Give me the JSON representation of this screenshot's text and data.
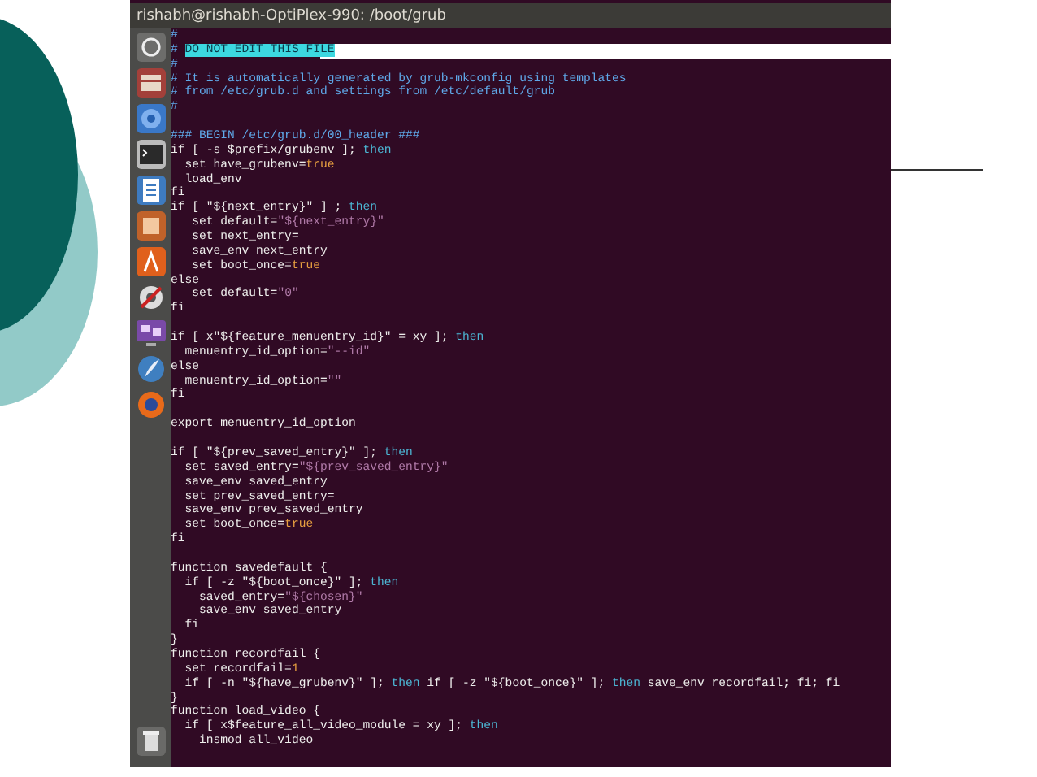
{
  "window": {
    "title": "rishabh@rishabh-OptiPlex-990: /boot/grub"
  },
  "terminal": {
    "lines": [
      {
        "kind": "code",
        "segments": [
          {
            "text": "#",
            "kind": "comment"
          }
        ]
      },
      {
        "kind": "code",
        "highlighted": true,
        "segments": [
          {
            "text": "# ",
            "kind": "comment"
          },
          {
            "text": "DO NOT EDIT THIS FILE",
            "kind": "selection"
          }
        ]
      },
      {
        "kind": "code",
        "segments": [
          {
            "text": "#",
            "kind": "comment"
          }
        ]
      },
      {
        "kind": "code",
        "segments": [
          {
            "text": "# It is automatically generated by grub-mkconfig using templates",
            "kind": "comment"
          }
        ]
      },
      {
        "kind": "code",
        "segments": [
          {
            "text": "# from /etc/grub.d and settings from /etc/default/grub",
            "kind": "comment"
          }
        ]
      },
      {
        "kind": "code",
        "segments": [
          {
            "text": "#",
            "kind": "comment"
          }
        ]
      },
      {
        "kind": "blank"
      },
      {
        "kind": "code",
        "segments": [
          {
            "text": "### BEGIN /etc/grub.d/00_header ###",
            "kind": "comment"
          }
        ]
      },
      {
        "kind": "code",
        "segments": [
          {
            "text": "if [ -s $prefix/grubenv ]; ",
            "kind": "text"
          },
          {
            "text": "then",
            "kind": "keyword"
          }
        ]
      },
      {
        "kind": "code",
        "segments": [
          {
            "text": "  set have_grubenv=",
            "kind": "text"
          },
          {
            "text": "true",
            "kind": "literal"
          }
        ]
      },
      {
        "kind": "code",
        "segments": [
          {
            "text": "  load_env",
            "kind": "text"
          }
        ]
      },
      {
        "kind": "code",
        "segments": [
          {
            "text": "fi",
            "kind": "text"
          }
        ]
      },
      {
        "kind": "code",
        "segments": [
          {
            "text": "if [ \"${next_entry}\" ] ; ",
            "kind": "text"
          },
          {
            "text": "then",
            "kind": "keyword"
          }
        ]
      },
      {
        "kind": "code",
        "segments": [
          {
            "text": "   set default=",
            "kind": "text"
          },
          {
            "text": "\"${next_entry}\"",
            "kind": "string"
          }
        ]
      },
      {
        "kind": "code",
        "segments": [
          {
            "text": "   set next_entry=",
            "kind": "text"
          }
        ]
      },
      {
        "kind": "code",
        "segments": [
          {
            "text": "   save_env next_entry",
            "kind": "text"
          }
        ]
      },
      {
        "kind": "code",
        "segments": [
          {
            "text": "   set boot_once=",
            "kind": "text"
          },
          {
            "text": "true",
            "kind": "literal"
          }
        ]
      },
      {
        "kind": "code",
        "segments": [
          {
            "text": "else",
            "kind": "text"
          }
        ]
      },
      {
        "kind": "code",
        "segments": [
          {
            "text": "   set default=",
            "kind": "text"
          },
          {
            "text": "\"0\"",
            "kind": "string"
          }
        ]
      },
      {
        "kind": "code",
        "segments": [
          {
            "text": "fi",
            "kind": "text"
          }
        ]
      },
      {
        "kind": "blank"
      },
      {
        "kind": "code",
        "segments": [
          {
            "text": "if [ x\"${feature_menuentry_id}\" = xy ]; ",
            "kind": "text"
          },
          {
            "text": "then",
            "kind": "keyword"
          }
        ]
      },
      {
        "kind": "code",
        "segments": [
          {
            "text": "  menuentry_id_option=",
            "kind": "text"
          },
          {
            "text": "\"--id\"",
            "kind": "string"
          }
        ]
      },
      {
        "kind": "code",
        "segments": [
          {
            "text": "else",
            "kind": "text"
          }
        ]
      },
      {
        "kind": "code",
        "segments": [
          {
            "text": "  menuentry_id_option=",
            "kind": "text"
          },
          {
            "text": "\"\"",
            "kind": "string"
          }
        ]
      },
      {
        "kind": "code",
        "segments": [
          {
            "text": "fi",
            "kind": "text"
          }
        ]
      },
      {
        "kind": "blank"
      },
      {
        "kind": "code",
        "segments": [
          {
            "text": "export menuentry_id_option",
            "kind": "text"
          }
        ]
      },
      {
        "kind": "blank"
      },
      {
        "kind": "code",
        "segments": [
          {
            "text": "if [ \"${prev_saved_entry}\" ]; ",
            "kind": "text"
          },
          {
            "text": "then",
            "kind": "keyword"
          }
        ]
      },
      {
        "kind": "code",
        "segments": [
          {
            "text": "  set saved_entry=",
            "kind": "text"
          },
          {
            "text": "\"${prev_saved_entry}\"",
            "kind": "string"
          }
        ]
      },
      {
        "kind": "code",
        "segments": [
          {
            "text": "  save_env saved_entry",
            "kind": "text"
          }
        ]
      },
      {
        "kind": "code",
        "segments": [
          {
            "text": "  set prev_saved_entry=",
            "kind": "text"
          }
        ]
      },
      {
        "kind": "code",
        "segments": [
          {
            "text": "  save_env prev_saved_entry",
            "kind": "text"
          }
        ]
      },
      {
        "kind": "code",
        "segments": [
          {
            "text": "  set boot_once=",
            "kind": "text"
          },
          {
            "text": "true",
            "kind": "literal"
          }
        ]
      },
      {
        "kind": "code",
        "segments": [
          {
            "text": "fi",
            "kind": "text"
          }
        ]
      },
      {
        "kind": "blank"
      },
      {
        "kind": "code",
        "segments": [
          {
            "text": "function savedefault {",
            "kind": "text"
          }
        ]
      },
      {
        "kind": "code",
        "segments": [
          {
            "text": "  if [ -z \"${boot_once}\" ]; ",
            "kind": "text"
          },
          {
            "text": "then",
            "kind": "keyword"
          }
        ]
      },
      {
        "kind": "code",
        "segments": [
          {
            "text": "    saved_entry=",
            "kind": "text"
          },
          {
            "text": "\"${chosen}\"",
            "kind": "string"
          }
        ]
      },
      {
        "kind": "code",
        "segments": [
          {
            "text": "    save_env saved_entry",
            "kind": "text"
          }
        ]
      },
      {
        "kind": "code",
        "segments": [
          {
            "text": "  fi",
            "kind": "text"
          }
        ]
      },
      {
        "kind": "code",
        "segments": [
          {
            "text": "}",
            "kind": "text"
          }
        ]
      },
      {
        "kind": "code",
        "segments": [
          {
            "text": "function recordfail {",
            "kind": "text"
          }
        ]
      },
      {
        "kind": "code",
        "segments": [
          {
            "text": "  set recordfail=",
            "kind": "text"
          },
          {
            "text": "1",
            "kind": "literal"
          }
        ]
      },
      {
        "kind": "code",
        "segments": [
          {
            "text": "  if [ -n \"${have_grubenv}\" ]; ",
            "kind": "text"
          },
          {
            "text": "then",
            "kind": "keyword"
          },
          {
            "text": " if [ -z \"${boot_once}\" ]; ",
            "kind": "text"
          },
          {
            "text": "then",
            "kind": "keyword"
          },
          {
            "text": " save_env recordfail; fi; fi",
            "kind": "text"
          }
        ]
      },
      {
        "kind": "code",
        "segments": [
          {
            "text": "}",
            "kind": "text"
          }
        ]
      },
      {
        "kind": "code",
        "segments": [
          {
            "text": "function load_video {",
            "kind": "text"
          }
        ]
      },
      {
        "kind": "code",
        "segments": [
          {
            "text": "  if [ x$feature_all_video_module = xy ]; ",
            "kind": "text"
          },
          {
            "text": "then",
            "kind": "keyword"
          }
        ]
      },
      {
        "kind": "code",
        "segments": [
          {
            "text": "    insmod all_video",
            "kind": "text"
          }
        ]
      }
    ]
  }
}
